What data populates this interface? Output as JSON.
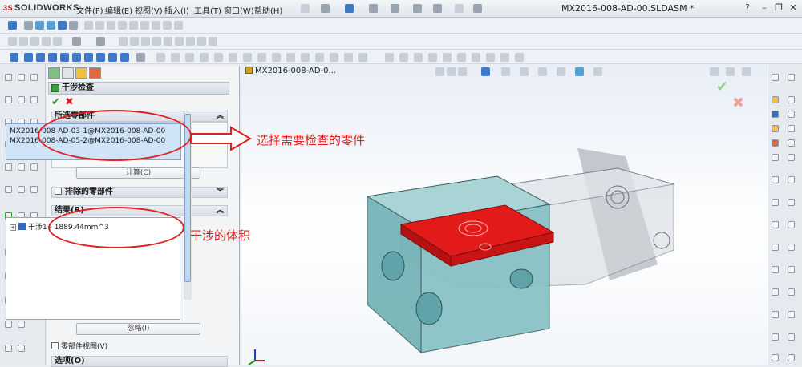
{
  "app": {
    "logo_ds": "3S",
    "logo_text": "SOLIDWORKS"
  },
  "menu": [
    "文件(F)",
    "编辑(E)",
    "视图(V)",
    "插入(I)",
    "工具(T)",
    "窗口(W)",
    "帮助(H)"
  ],
  "window": {
    "doc_title": "MX2016-008-AD-00.SLDASM *",
    "help": "?",
    "minimize": "–",
    "restore": "❐",
    "close": "✕"
  },
  "graphics": {
    "doc_tab": "MX2016-008-AD-0..."
  },
  "pm": {
    "title": "干涉检查",
    "ok": "✔",
    "cancel": "✖",
    "selected_group": {
      "title": "所选零部件",
      "items": [
        "MX2016-008-AD-03-1@MX2016-008-AD-00",
        "MX2016-008-AD-05-2@MX2016-008-AD-00"
      ]
    },
    "calc_button": "计算(C)",
    "excluded_group": {
      "title": "排除的零部件"
    },
    "results_group": {
      "title": "结果(R)",
      "row": "干涉1 - 1889.44mm^3"
    },
    "ignore_button": "忽略(I)",
    "component_view": "零部件视图(V)",
    "options_group": {
      "title": "选项(O)"
    }
  },
  "annotations": {
    "select_parts": "选择需要检查的零件",
    "interference_volume": "干涉的体积"
  },
  "colors": {
    "interference": "#e21a1a",
    "part_teal": "#7fc1c4",
    "annotation": "#e02020"
  }
}
